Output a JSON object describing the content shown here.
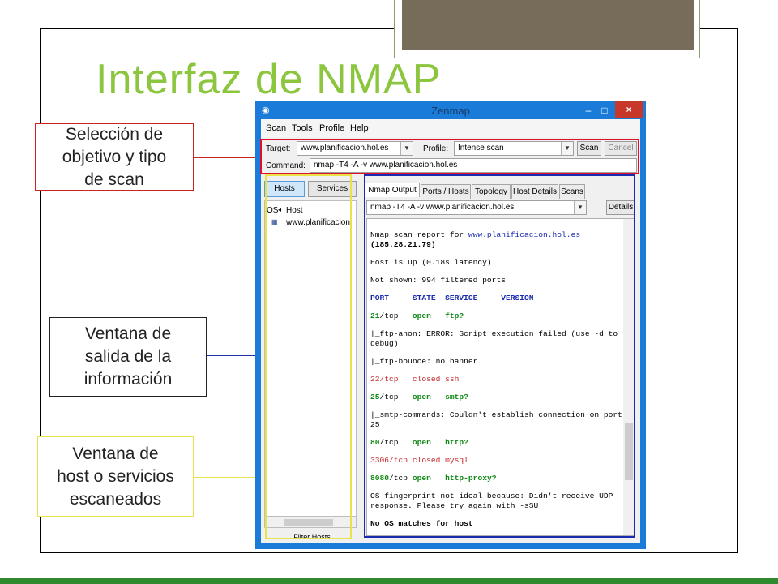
{
  "slide": {
    "title": "Interfaz de NMAP",
    "colors": {
      "title": "#8cc63f",
      "bottom_rule": "#2f8a2f",
      "tab_fill": "#776c5a"
    }
  },
  "callouts": [
    {
      "lines": [
        "Selección de",
        "objetivo  y tipo",
        "de scan"
      ],
      "border": "#cc2222"
    },
    {
      "lines": [
        "Ventana de",
        "salida de la",
        "información"
      ],
      "border": "#222222"
    },
    {
      "lines": [
        "Ventana de",
        "host o servicios",
        "escaneados"
      ],
      "border": "#e8e34a"
    }
  ],
  "window": {
    "title": "Zenmap",
    "app_icon": "eye-icon",
    "controls": {
      "minimize": "–",
      "maximize": "□",
      "close": "×"
    },
    "menu": [
      "Scan",
      "Tools",
      "Profile",
      "Help"
    ],
    "target_label": "Target:",
    "target_value": "www.planificacion.hol.es",
    "profile_label": "Profile:",
    "profile_value": "Intense scan",
    "scan_button": "Scan",
    "cancel_button": "Cancel",
    "command_label": "Command:",
    "command_value": "nmap -T4 -A -v www.planificacion.hol.es",
    "left_buttons": [
      "Hosts",
      "Services"
    ],
    "host_columns": [
      "OS",
      "Host"
    ],
    "hosts": [
      {
        "name": "www.planificacion."
      }
    ],
    "filter_button": "Filter Hosts",
    "tabs": [
      "Nmap Output",
      "Ports / Hosts",
      "Topology",
      "Host Details",
      "Scans"
    ],
    "output_select": "nmap -T4 -A -v www.planificacion.hol.es",
    "details_button": "Details",
    "colors": {
      "frame": "#1b7bd8",
      "close": "#c7372a",
      "open_port": "#118a18",
      "closed_port": "#c4282b",
      "link": "#1a2bb0"
    }
  },
  "output": {
    "report_prefix": "Nmap scan report for ",
    "report_host": "www.planificacion.hol.es",
    "report_ip": "(185.28.21.79)",
    "host_up": "Host is up (0.18s latency).",
    "not_shown": "Not shown: 994 filtered ports",
    "header": "PORT     STATE  SERVICE     VERSION",
    "p21": {
      "port": "21",
      "proto": "/tcp",
      "state": "open",
      "service": "ftp?"
    },
    "ftp_anon_1": "|_ftp-anon: ERROR: Script execution failed (use -d to",
    "ftp_anon_2": "debug)",
    "ftp_bounce": "|_ftp-bounce: no banner",
    "p22": {
      "port": "22",
      "proto": "/tcp",
      "state": "closed",
      "service": "ssh"
    },
    "p25": {
      "port": "25",
      "proto": "/tcp",
      "state": "open",
      "service": "smtp?"
    },
    "smtp_1": "|_smtp-commands: Couldn't establish connection on port",
    "smtp_2": "25",
    "p80": {
      "port": "80",
      "proto": "/tcp",
      "state": "open",
      "service": "http?"
    },
    "p3306": {
      "port": "3306",
      "proto": "/tcp",
      "state": "closed",
      "service": "mysql"
    },
    "p8080": {
      "port": "8080",
      "proto": "/tcp",
      "state": "open",
      "service": "http-proxy?"
    },
    "os_fp_1": "OS fingerprint not ideal because: Didn't receive UDP",
    "os_fp_2": "response. Please try again with -sSU",
    "no_os": "No OS matches for host"
  }
}
